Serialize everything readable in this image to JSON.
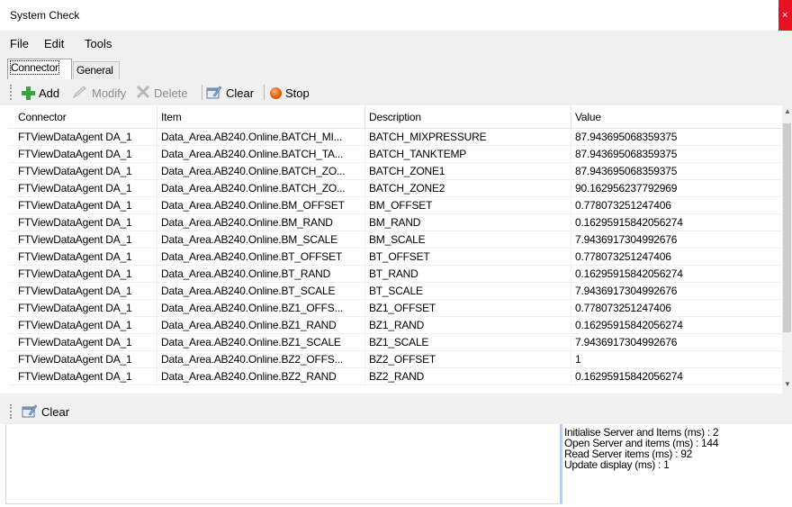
{
  "window": {
    "title": "System Check",
    "close_glyph": "×"
  },
  "menu": {
    "items": [
      "File",
      "Edit",
      "Tools"
    ]
  },
  "tabs": [
    {
      "label": "Connector",
      "active": true
    },
    {
      "label": "General",
      "active": false
    }
  ],
  "toolbar": {
    "add": {
      "label": "Add",
      "icon": "plus-icon",
      "enabled": true
    },
    "modify": {
      "label": "Modify",
      "icon": "pencil-icon",
      "enabled": false
    },
    "delete": {
      "label": "Delete",
      "icon": "x-icon",
      "enabled": false
    },
    "clear": {
      "label": "Clear",
      "icon": "clear-icon",
      "enabled": true
    },
    "stop": {
      "label": "Stop",
      "icon": "stop-icon",
      "enabled": true
    }
  },
  "table": {
    "columns": [
      "Connector",
      "Item",
      "Description",
      "Value"
    ],
    "rows": [
      [
        "FTViewDataAgent DA_1",
        "Data_Area.AB240.Online.BATCH_MI...",
        "BATCH_MIXPRESSURE",
        "87.943695068359375"
      ],
      [
        "FTViewDataAgent DA_1",
        "Data_Area.AB240.Online.BATCH_TA...",
        "BATCH_TANKTEMP",
        "87.943695068359375"
      ],
      [
        "FTViewDataAgent DA_1",
        "Data_Area.AB240.Online.BATCH_ZO...",
        "BATCH_ZONE1",
        "87.943695068359375"
      ],
      [
        "FTViewDataAgent DA_1",
        "Data_Area.AB240.Online.BATCH_ZO...",
        "BATCH_ZONE2",
        "90.162956237792969"
      ],
      [
        "FTViewDataAgent DA_1",
        "Data_Area.AB240.Online.BM_OFFSET",
        "BM_OFFSET",
        "0.778073251247406"
      ],
      [
        "FTViewDataAgent DA_1",
        "Data_Area.AB240.Online.BM_RAND",
        "BM_RAND",
        "0.16295915842056274"
      ],
      [
        "FTViewDataAgent DA_1",
        "Data_Area.AB240.Online.BM_SCALE",
        "BM_SCALE",
        "7.9436917304992676"
      ],
      [
        "FTViewDataAgent DA_1",
        "Data_Area.AB240.Online.BT_OFFSET",
        "BT_OFFSET",
        "0.778073251247406"
      ],
      [
        "FTViewDataAgent DA_1",
        "Data_Area.AB240.Online.BT_RAND",
        "BT_RAND",
        "0.16295915842056274"
      ],
      [
        "FTViewDataAgent DA_1",
        "Data_Area.AB240.Online.BT_SCALE",
        "BT_SCALE",
        "7.9436917304992676"
      ],
      [
        "FTViewDataAgent DA_1",
        "Data_Area.AB240.Online.BZ1_OFFS...",
        "BZ1_OFFSET",
        "0.778073251247406"
      ],
      [
        "FTViewDataAgent DA_1",
        "Data_Area.AB240.Online.BZ1_RAND",
        "BZ1_RAND",
        "0.16295915842056274"
      ],
      [
        "FTViewDataAgent DA_1",
        "Data_Area.AB240.Online.BZ1_SCALE",
        "BZ1_SCALE",
        "7.9436917304992676"
      ],
      [
        "FTViewDataAgent DA_1",
        "Data_Area.AB240.Online.BZ2_OFFS...",
        "BZ2_OFFSET",
        "1"
      ],
      [
        "FTViewDataAgent DA_1",
        "Data_Area.AB240.Online.BZ2_RAND",
        "BZ2_RAND",
        "0.16295915842056274"
      ]
    ]
  },
  "log_toolbar": {
    "clear": {
      "label": "Clear",
      "icon": "clear-icon"
    }
  },
  "stats": [
    "Initialise Server and Items (ms) : 2",
    "Open Server and items (ms) : 144",
    "Read Server items (ms) : 92",
    "Update display (ms) : 1"
  ],
  "colors": {
    "chrome": "#f0f0f0",
    "close": "#e81123",
    "add_green": "#3aa53a",
    "stop_orange": "#e05a00",
    "splitter_blue": "#b9d1ea"
  }
}
